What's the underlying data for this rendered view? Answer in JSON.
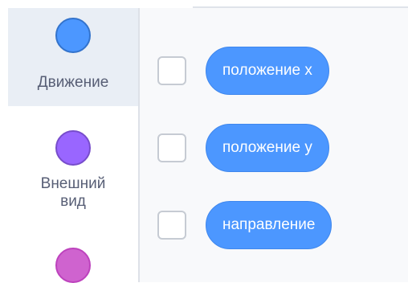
{
  "categories": [
    {
      "label": "Движение",
      "color": "#4c97ff",
      "border": "#3373cc",
      "selected": true
    },
    {
      "label_line1": "Внешний",
      "label_line2": "вид",
      "color": "#9966ff",
      "border": "#774dcb"
    },
    {
      "color": "#cf63cf",
      "border": "#bd42bd"
    }
  ],
  "blocks": [
    {
      "label": "положение x",
      "checked": false
    },
    {
      "label": "положение y",
      "checked": false
    },
    {
      "label": "направление",
      "checked": false
    }
  ],
  "colors": {
    "motion_block": "#4c97ff",
    "selected_category_bg": "#e9eef5",
    "category_text": "#575e75"
  }
}
